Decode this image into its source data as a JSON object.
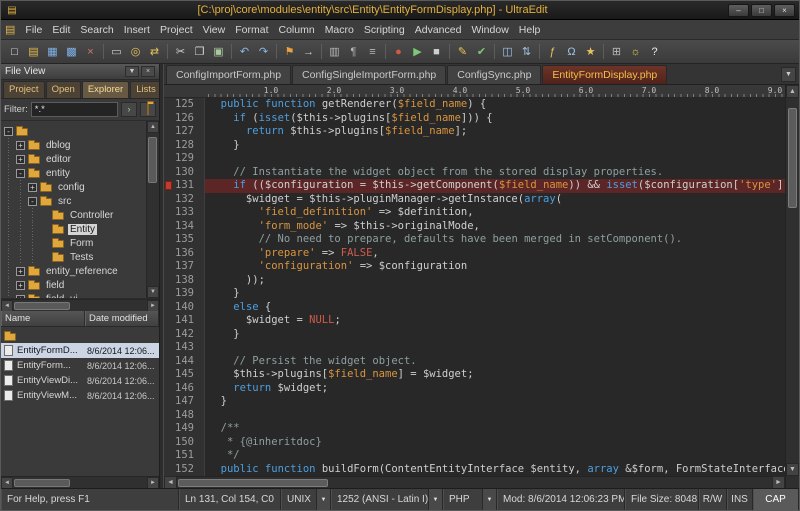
{
  "colors": {
    "accent_gold": "#e5b13d",
    "active_line_bg": "#5d2626",
    "keyword": "#4d9fe0",
    "string": "#d9953f",
    "comment": "#8f9f9f",
    "constant": "#cf5b4a",
    "active_tab_text": "#f2c04a"
  },
  "titlebar": {
    "title": "[C:\\proj\\core\\modules\\entity\\src\\Entity\\EntityFormDisplay.php] - UltraEdit",
    "minimize": "–",
    "maximize": "□",
    "close": "×",
    "app_icon": "▤"
  },
  "menubar": {
    "doc_icon": "▤",
    "items": [
      "File",
      "Edit",
      "Search",
      "Insert",
      "Project",
      "View",
      "Format",
      "Column",
      "Macro",
      "Scripting",
      "Advanced",
      "Window",
      "Help"
    ]
  },
  "toolbar": {
    "groups": [
      [
        {
          "name": "new-file",
          "glyph": "□",
          "color": "#e6e6e6"
        },
        {
          "name": "open-file",
          "glyph": "▤",
          "color": "#e6b84c"
        },
        {
          "name": "save",
          "glyph": "▦",
          "color": "#7fb2e8"
        },
        {
          "name": "save-all",
          "glyph": "▩",
          "color": "#7fb2e8"
        },
        {
          "name": "close-file",
          "glyph": "×",
          "color": "#d07a6a"
        }
      ],
      [
        {
          "name": "print",
          "glyph": "▭",
          "color": "#cfcfcf"
        },
        {
          "name": "find",
          "glyph": "◎",
          "color": "#e6c45c"
        },
        {
          "name": "replace",
          "glyph": "⇄",
          "color": "#e6c45c"
        }
      ],
      [
        {
          "name": "cut",
          "glyph": "✂",
          "color": "#d8d8d8"
        },
        {
          "name": "copy",
          "glyph": "❐",
          "color": "#d8d8d8"
        },
        {
          "name": "paste",
          "glyph": "▣",
          "color": "#a8c8a0"
        }
      ],
      [
        {
          "name": "undo",
          "glyph": "↶",
          "color": "#8ab8e8"
        },
        {
          "name": "redo",
          "glyph": "↷",
          "color": "#8ab8e8"
        }
      ],
      [
        {
          "name": "bookmark",
          "glyph": "⚑",
          "color": "#e8a040"
        },
        {
          "name": "goto-line",
          "glyph": "→",
          "color": "#cfcfcf"
        }
      ],
      [
        {
          "name": "column-mode",
          "glyph": "▥",
          "color": "#b8b8b8"
        },
        {
          "name": "word-wrap",
          "glyph": "¶",
          "color": "#b8b8b8"
        },
        {
          "name": "show-invisibles",
          "glyph": "≡",
          "color": "#b8b8b8"
        }
      ],
      [
        {
          "name": "macro-record",
          "glyph": "●",
          "color": "#d05a4a"
        },
        {
          "name": "macro-play",
          "glyph": "▶",
          "color": "#7ac87a"
        },
        {
          "name": "macro-stop",
          "glyph": "■",
          "color": "#cfcfcf"
        }
      ],
      [
        {
          "name": "script-edit",
          "glyph": "✎",
          "color": "#e6c45c"
        },
        {
          "name": "script-run",
          "glyph": "✔",
          "color": "#7ac87a"
        }
      ],
      [
        {
          "name": "compare-files",
          "glyph": "◫",
          "color": "#9fc5e8"
        },
        {
          "name": "sort",
          "glyph": "⇅",
          "color": "#9fc5e8"
        }
      ],
      [
        {
          "name": "function-list",
          "glyph": "ƒ",
          "color": "#e6c45c"
        },
        {
          "name": "tag-list",
          "glyph": "Ω",
          "color": "#9fc5e8"
        },
        {
          "name": "templates",
          "glyph": "★",
          "color": "#e6c45c"
        }
      ],
      [
        {
          "name": "settings",
          "glyph": "⊞",
          "color": "#b8b8b8"
        },
        {
          "name": "tips",
          "glyph": "☼",
          "color": "#f0d050"
        },
        {
          "name": "help",
          "glyph": "?",
          "color": "#e8e8e8"
        }
      ]
    ]
  },
  "sidebar": {
    "header": {
      "title": "File View",
      "menu_icon": "▼",
      "close_icon": "×"
    },
    "tabs": [
      {
        "label": "Project"
      },
      {
        "label": "Open"
      },
      {
        "label": "Explorer",
        "active": true
      },
      {
        "label": "Lists"
      }
    ],
    "filter": {
      "label": "Filter:",
      "value": "*.*",
      "go_label": "›"
    },
    "tree": [
      {
        "label": "",
        "depth": 0,
        "exp": "-"
      },
      {
        "label": "dblog",
        "depth": 1,
        "exp": "+"
      },
      {
        "label": "editor",
        "depth": 1,
        "exp": "+"
      },
      {
        "label": "entity",
        "depth": 1,
        "exp": "-"
      },
      {
        "label": "config",
        "depth": 2,
        "exp": "+"
      },
      {
        "label": "src",
        "depth": 2,
        "exp": "-"
      },
      {
        "label": "Controller",
        "depth": 3
      },
      {
        "label": "Entity",
        "depth": 3,
        "selected": true
      },
      {
        "label": "Form",
        "depth": 3
      },
      {
        "label": "Tests",
        "depth": 3
      },
      {
        "label": "entity_reference",
        "depth": 1,
        "exp": "+"
      },
      {
        "label": "field",
        "depth": 1,
        "exp": "+"
      },
      {
        "label": "field_ui",
        "depth": 1,
        "exp": "+"
      }
    ],
    "list": {
      "columns": [
        "Name",
        "Date modified"
      ],
      "rows": [
        {
          "name": "",
          "date": "",
          "icon": "folder"
        },
        {
          "name": "EntityFormD...",
          "date": "8/6/2014 12:06...",
          "icon": "doc",
          "selected": true
        },
        {
          "name": "EntityForm...",
          "date": "8/6/2014 12:06...",
          "icon": "doc"
        },
        {
          "name": "EntityViewDi...",
          "date": "8/6/2014 12:06...",
          "icon": "doc"
        },
        {
          "name": "EntityViewM...",
          "date": "8/6/2014 12:06...",
          "icon": "doc"
        }
      ]
    }
  },
  "editor": {
    "tabs": [
      {
        "label": "ConfigImportForm.php"
      },
      {
        "label": "ConfigSingleImportForm.php"
      },
      {
        "label": "ConfigSync.php"
      },
      {
        "label": "EntityFormDisplay.php",
        "active": true
      }
    ],
    "tab_list_icon": "▼",
    "ruler_marks": [
      "1.0",
      "2.0",
      "3.0",
      "4.0",
      "5.0",
      "6.0",
      "7.0",
      "8.0",
      "9.0"
    ],
    "lines": [
      {
        "n": 125,
        "t": [
          [
            "p",
            "  "
          ],
          [
            "k",
            "public"
          ],
          [
            "p",
            " "
          ],
          [
            "k",
            "function"
          ],
          [
            "p",
            " getRenderer("
          ],
          [
            "s",
            "$field_name"
          ],
          [
            "p",
            ") {"
          ]
        ]
      },
      {
        "n": 126,
        "t": [
          [
            "p",
            "    "
          ],
          [
            "k",
            "if"
          ],
          [
            "p",
            " ("
          ],
          [
            "k",
            "isset"
          ],
          [
            "p",
            "($this->plugins["
          ],
          [
            "s",
            "$field_name"
          ],
          [
            "p",
            "])) {"
          ]
        ]
      },
      {
        "n": 127,
        "t": [
          [
            "p",
            "      "
          ],
          [
            "k",
            "return"
          ],
          [
            "p",
            " $this->plugins["
          ],
          [
            "s",
            "$field_name"
          ],
          [
            "p",
            "];"
          ]
        ]
      },
      {
        "n": 128,
        "t": [
          [
            "p",
            "    }"
          ]
        ]
      },
      {
        "n": 129,
        "t": []
      },
      {
        "n": 130,
        "t": [
          [
            "p",
            "    "
          ],
          [
            "c",
            "// Instantiate the widget object from the stored display properties."
          ]
        ]
      },
      {
        "n": 131,
        "hl": true,
        "t": [
          [
            "p",
            "    "
          ],
          [
            "k",
            "if"
          ],
          [
            "p",
            " (($configuration = $this->getComponent("
          ],
          [
            "s",
            "$field_name"
          ],
          [
            "p",
            ")) && "
          ],
          [
            "k",
            "isset"
          ],
          [
            "p",
            "($configuration["
          ],
          [
            "s",
            "'type'"
          ],
          [
            "p",
            "]) &"
          ]
        ]
      },
      {
        "n": 132,
        "t": [
          [
            "p",
            "      $widget = $this->pluginManager->getInstance("
          ],
          [
            "k",
            "array"
          ],
          [
            "p",
            "("
          ]
        ]
      },
      {
        "n": 133,
        "t": [
          [
            "p",
            "        "
          ],
          [
            "s",
            "'field_definition'"
          ],
          [
            "p",
            " => $definition,"
          ]
        ]
      },
      {
        "n": 134,
        "t": [
          [
            "p",
            "        "
          ],
          [
            "s",
            "'form_mode'"
          ],
          [
            "p",
            " => $this->originalMode,"
          ]
        ]
      },
      {
        "n": 135,
        "t": [
          [
            "p",
            "        "
          ],
          [
            "c",
            "// No need to prepare, defaults have been merged in setComponent()."
          ]
        ]
      },
      {
        "n": 136,
        "t": [
          [
            "p",
            "        "
          ],
          [
            "s",
            "'prepare'"
          ],
          [
            "p",
            " => "
          ],
          [
            "r",
            "FALSE"
          ],
          [
            "p",
            ","
          ]
        ]
      },
      {
        "n": 137,
        "t": [
          [
            "p",
            "        "
          ],
          [
            "s",
            "'configuration'"
          ],
          [
            "p",
            " => $configuration"
          ]
        ]
      },
      {
        "n": 138,
        "t": [
          [
            "p",
            "      ));"
          ]
        ]
      },
      {
        "n": 139,
        "t": [
          [
            "p",
            "    }"
          ]
        ]
      },
      {
        "n": 140,
        "t": [
          [
            "p",
            "    "
          ],
          [
            "k",
            "else"
          ],
          [
            "p",
            " {"
          ]
        ]
      },
      {
        "n": 141,
        "t": [
          [
            "p",
            "      $widget = "
          ],
          [
            "r",
            "NULL"
          ],
          [
            "p",
            ";"
          ]
        ]
      },
      {
        "n": 142,
        "t": [
          [
            "p",
            "    }"
          ]
        ]
      },
      {
        "n": 143,
        "t": []
      },
      {
        "n": 144,
        "t": [
          [
            "p",
            "    "
          ],
          [
            "c",
            "// Persist the widget object."
          ]
        ]
      },
      {
        "n": 145,
        "t": [
          [
            "p",
            "    $this->plugins["
          ],
          [
            "s",
            "$field_name"
          ],
          [
            "p",
            "] = $widget;"
          ]
        ]
      },
      {
        "n": 146,
        "t": [
          [
            "p",
            "    "
          ],
          [
            "k",
            "return"
          ],
          [
            "p",
            " $widget;"
          ]
        ]
      },
      {
        "n": 147,
        "t": [
          [
            "p",
            "  }"
          ]
        ]
      },
      {
        "n": 148,
        "t": []
      },
      {
        "n": 149,
        "t": [
          [
            "p",
            "  "
          ],
          [
            "c",
            "/**"
          ]
        ]
      },
      {
        "n": 150,
        "t": [
          [
            "p",
            "  "
          ],
          [
            "c",
            " * {@inheritdoc}"
          ]
        ]
      },
      {
        "n": 151,
        "t": [
          [
            "p",
            "  "
          ],
          [
            "c",
            " */"
          ]
        ]
      },
      {
        "n": 152,
        "t": [
          [
            "p",
            "  "
          ],
          [
            "k",
            "public"
          ],
          [
            "p",
            " "
          ],
          [
            "k",
            "function"
          ],
          [
            "p",
            " buildForm(ContentEntityInterface $entity, "
          ],
          [
            "k",
            "array"
          ],
          [
            "p",
            " &$form, FormStateInterface $"
          ]
        ]
      }
    ]
  },
  "statusbar": {
    "help": "For Help, press F1",
    "position": "Ln 131, Col 154, C0",
    "line_ending": "UNIX",
    "encoding": "1252 (ANSI - Latin I)",
    "syntax": "PHP",
    "modified": "Mod: 8/6/2014 12:06:23 PM",
    "file_size": "File Size: 8048",
    "read_write": "R/W",
    "insert_mode": "INS",
    "caps": "CAP",
    "dropdown_icon": "▼"
  }
}
